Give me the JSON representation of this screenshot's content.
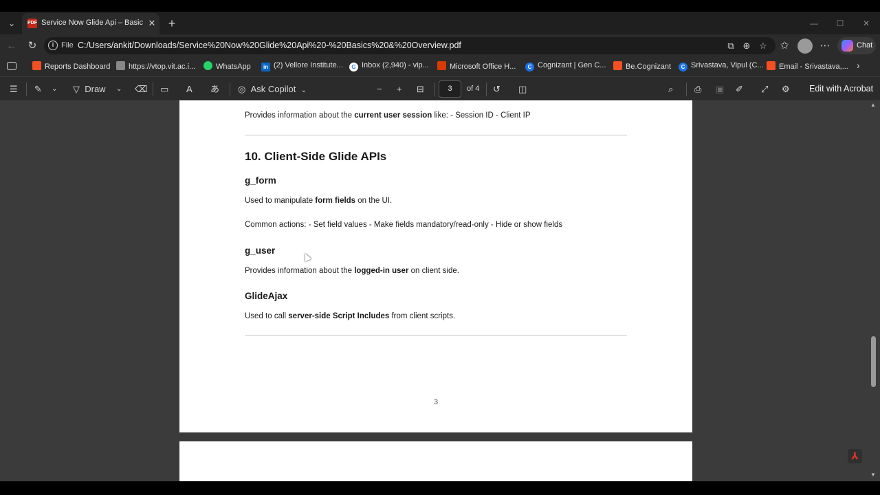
{
  "browser": {
    "tab": {
      "title": "Service Now Glide Api – Basics & Overview",
      "favicon": "pdf-icon"
    },
    "url_scheme": "File",
    "url": "C:/Users/ankit/Downloads/Service%20Now%20Glide%20Api%20-%20Basics%20&%20Overview.pdf",
    "chat_label": "Chat"
  },
  "bookmarks": [
    {
      "label": "Reports Dashboard",
      "icon": "windows-icon",
      "color": "#f25022"
    },
    {
      "label": "https://vtop.vit.ac.i...",
      "icon": "page-icon",
      "color": "#888888"
    },
    {
      "label": "WhatsApp",
      "icon": "whatsapp-icon",
      "color": "#25d366"
    },
    {
      "label": "(2) Vellore Institute...",
      "icon": "linkedin-icon",
      "color": "#0a66c2"
    },
    {
      "label": "Inbox (2,940) - vip...",
      "icon": "google-icon",
      "color": "#ffffff"
    },
    {
      "label": "Microsoft Office H...",
      "icon": "office-icon",
      "color": "#d83b01"
    },
    {
      "label": "Cognizant | Gen C...",
      "icon": "cognizant-icon",
      "color": "#1a73e8"
    },
    {
      "label": "Be.Cognizant",
      "icon": "windows-icon",
      "color": "#f25022"
    },
    {
      "label": "Srivastava, Vipul (C...",
      "icon": "cognizant-icon",
      "color": "#1a73e8"
    },
    {
      "label": "Email - Srivastava,...",
      "icon": "windows-icon",
      "color": "#f25022"
    }
  ],
  "pdf_toolbar": {
    "draw_label": "Draw",
    "ask_copilot_label": "Ask Copilot",
    "current_page": "3",
    "page_total": "of 4",
    "edit_acrobat_label": "Edit with Acrobat"
  },
  "document": {
    "intro_prefix": "Provides information about the ",
    "intro_bold": "current user session",
    "intro_suffix": " like: - Session ID - Client IP",
    "section_heading": "10. Client-Side Glide APIs",
    "g_form_heading": "g_form",
    "g_form_p1_prefix": "Used to manipulate ",
    "g_form_p1_bold": "form fields",
    "g_form_p1_suffix": " on the UI.",
    "g_form_p2": "Common actions: - Set field values - Make fields mandatory/read-only - Hide or show fields",
    "g_user_heading": "g_user",
    "g_user_p_prefix": "Provides information about the ",
    "g_user_p_bold": "logged-in user",
    "g_user_p_suffix": " on client side.",
    "glideajax_heading": "GlideAjax",
    "glideajax_p_prefix": "Used to call ",
    "glideajax_p_bold": "server-side Script Includes",
    "glideajax_p_suffix": " from client scripts.",
    "page_number": "3"
  }
}
